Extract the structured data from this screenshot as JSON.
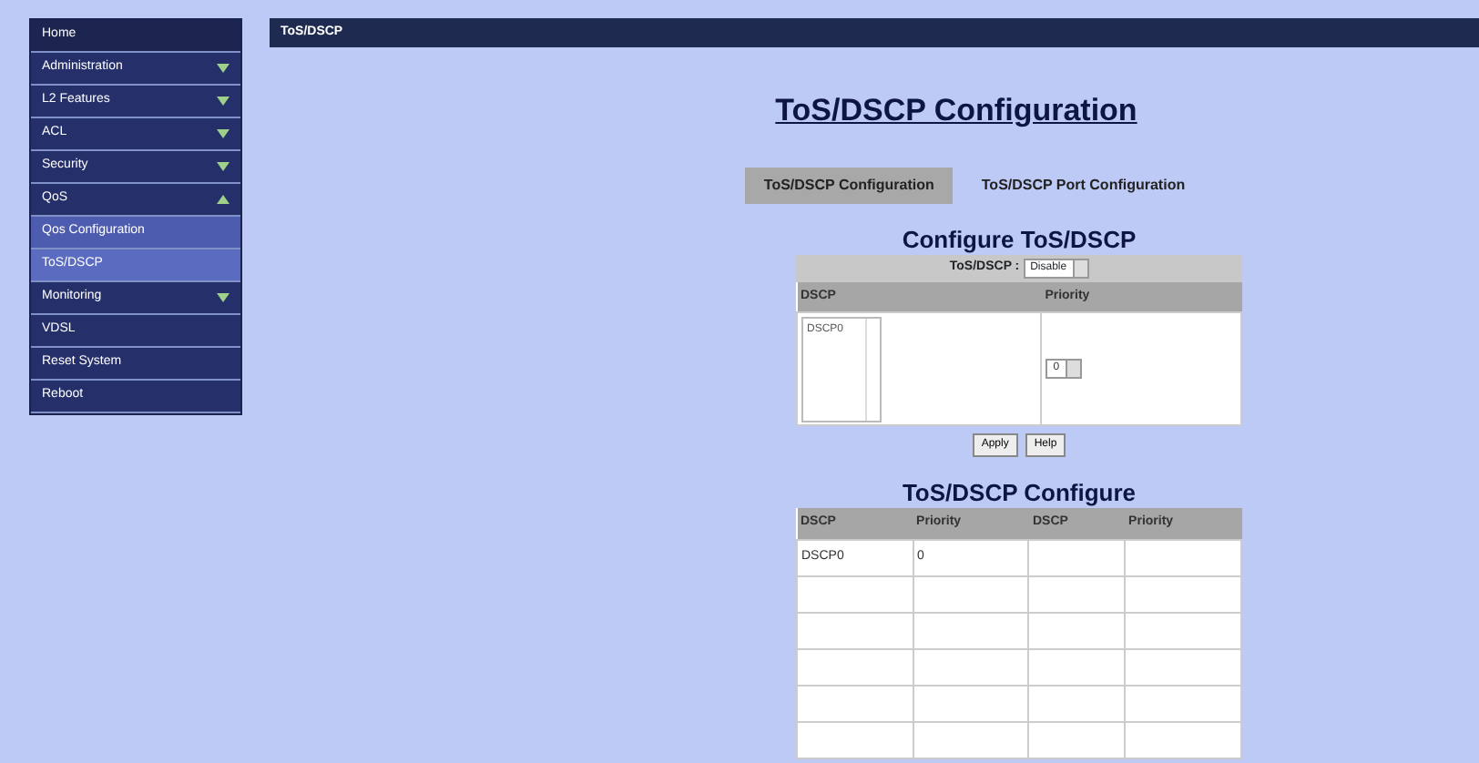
{
  "sidebar": {
    "items": [
      {
        "label": "Home",
        "kind": "link",
        "selected": false
      },
      {
        "label": "Administration",
        "kind": "group",
        "expanded": false,
        "selected": false
      },
      {
        "label": "L2 Features",
        "kind": "group",
        "expanded": false,
        "selected": false
      },
      {
        "label": "ACL",
        "kind": "group",
        "expanded": false,
        "selected": false
      },
      {
        "label": "Security",
        "kind": "group",
        "expanded": false,
        "selected": false
      },
      {
        "label": "QoS",
        "kind": "group",
        "expanded": true,
        "selected": false
      },
      {
        "label": "Qos Configuration",
        "kind": "sub",
        "selected": false
      },
      {
        "label": "ToS/DSCP",
        "kind": "sub",
        "selected": true
      },
      {
        "label": "Monitoring",
        "kind": "group",
        "expanded": false,
        "selected": false
      },
      {
        "label": "VDSL",
        "kind": "link",
        "selected": false
      },
      {
        "label": "Reset System",
        "kind": "link",
        "selected": false
      },
      {
        "label": "Reboot",
        "kind": "link",
        "selected": false
      }
    ]
  },
  "header": {
    "title": "ToS/DSCP"
  },
  "page_title": "ToS/DSCP Configuration",
  "tabs": [
    {
      "label": "ToS/DSCP Configuration",
      "selected": true
    },
    {
      "label": "ToS/DSCP Port Configuration",
      "selected": false
    }
  ],
  "config": {
    "title": "Configure ToS/DSCP",
    "mode_label": "ToS/DSCP :",
    "mode_value": "Disable",
    "columns": [
      "DSCP",
      "Priority"
    ],
    "dscp_options": [
      "DSCP0"
    ],
    "priority_value": "0",
    "buttons": [
      "Apply",
      "Help"
    ]
  },
  "summary": {
    "title": "ToS/DSCP Configure",
    "columns": [
      "DSCP",
      "Priority",
      "DSCP",
      "Priority"
    ],
    "rows": [
      {
        "cells": [
          "DSCP0",
          "0"
        ]
      },
      {},
      {},
      {},
      {},
      {}
    ]
  }
}
